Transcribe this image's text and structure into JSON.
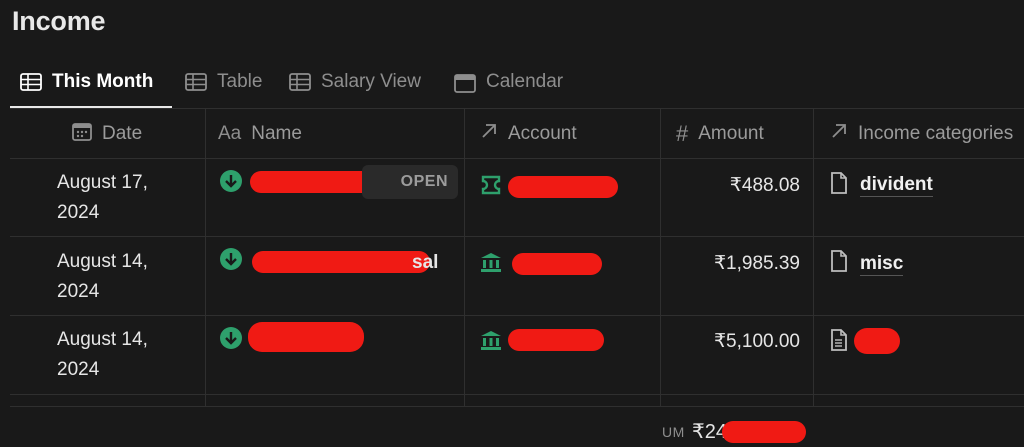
{
  "page": {
    "title": "Income"
  },
  "tabs": [
    {
      "label": "This Month",
      "icon": "table-icon",
      "active": true
    },
    {
      "label": "Table",
      "icon": "table-icon",
      "active": false
    },
    {
      "label": "Salary View",
      "icon": "table-icon",
      "active": false
    },
    {
      "label": "Calendar",
      "icon": "calendar-icon",
      "active": false
    }
  ],
  "columns": {
    "date": {
      "label": "Date",
      "icon": "calendar-icon"
    },
    "name": {
      "label": "Name",
      "icon_text": "Aa"
    },
    "account": {
      "label": "Account",
      "icon": "relation-arrow-icon"
    },
    "amount": {
      "label": "Amount",
      "icon_text": "#"
    },
    "category": {
      "label": "Income categories",
      "icon": "relation-arrow-icon"
    }
  },
  "rows": [
    {
      "date_line1": "August 17,",
      "date_line2": "2024",
      "name_suffix": "",
      "amount": "₹488.08",
      "category": "divident",
      "open_label": "OPEN"
    },
    {
      "date_line1": "August 14,",
      "date_line2": "2024",
      "name_suffix": "sal",
      "amount": "₹1,985.39",
      "category": "misc"
    },
    {
      "date_line1": "August 14,",
      "date_line2": "2024",
      "name_suffix": "",
      "amount": "₹5,100.00",
      "category": ""
    }
  ],
  "summary": {
    "label": "UM",
    "value": "₹24"
  },
  "colors": {
    "accent_green": "#2ea06c",
    "redaction": "#f01a14",
    "background": "#191919"
  }
}
